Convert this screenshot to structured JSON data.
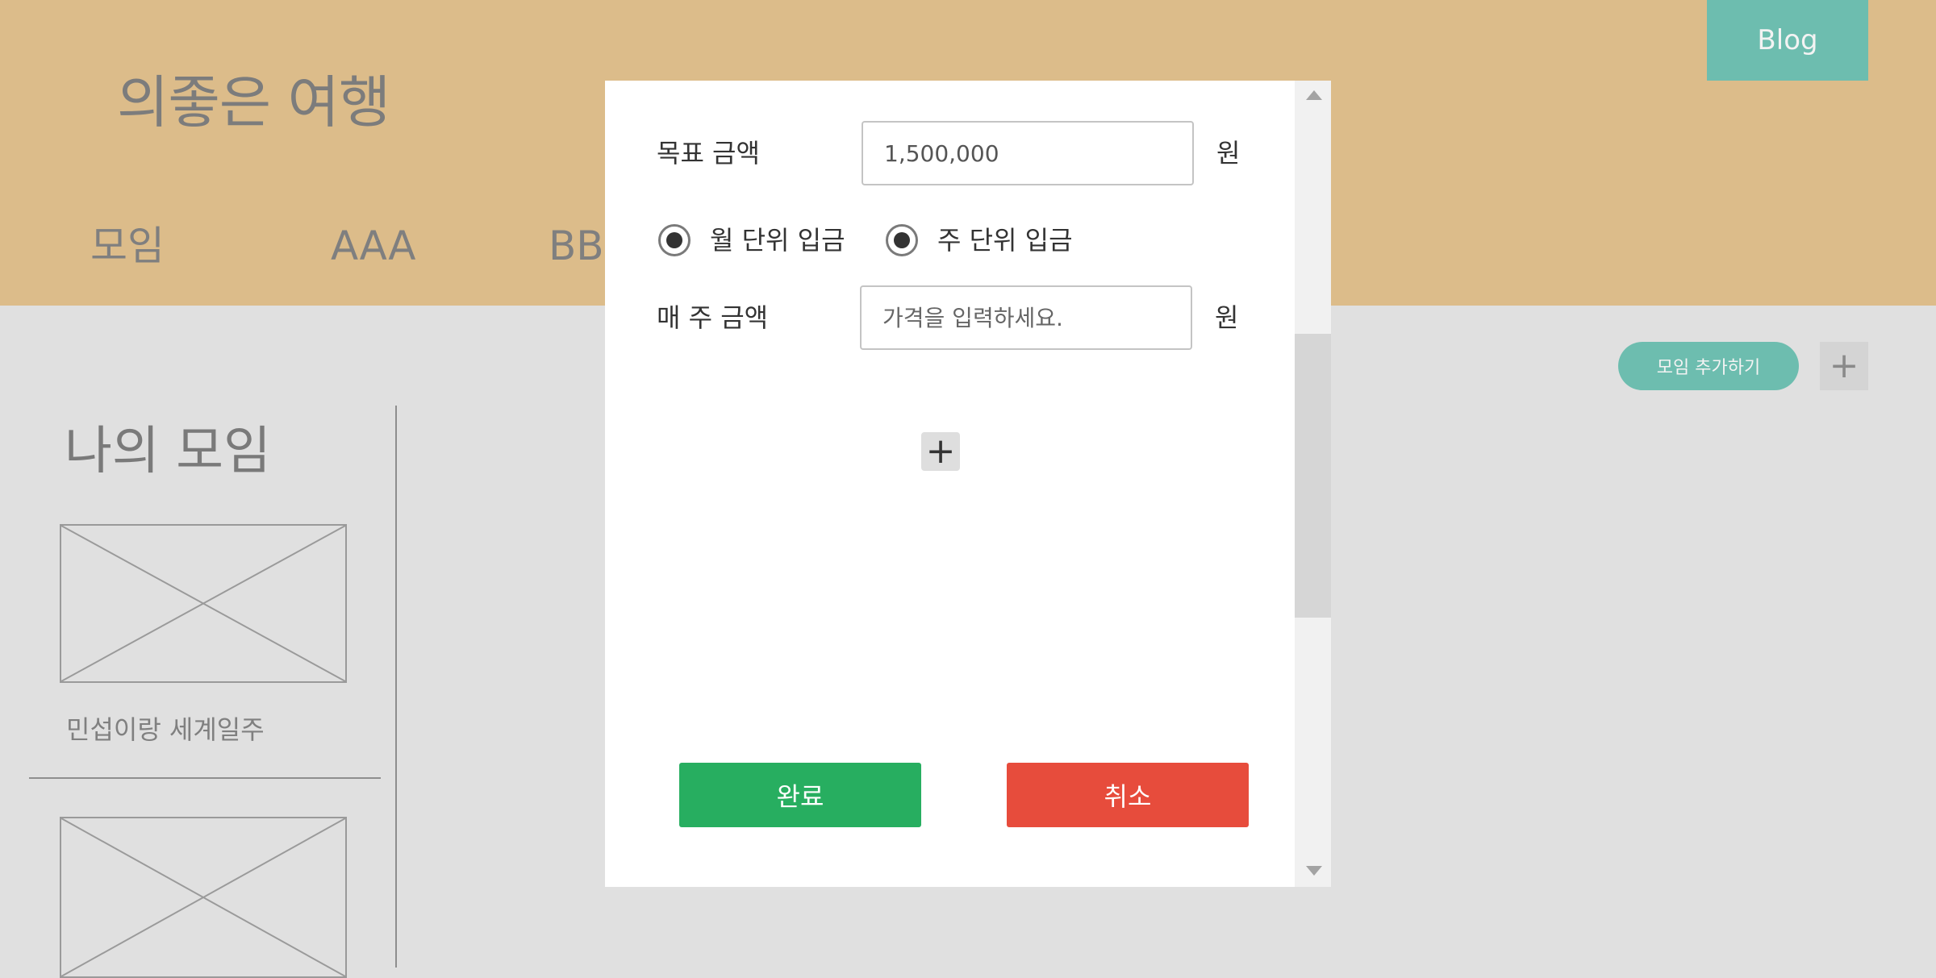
{
  "header": {
    "site_title": "의좋은 여행",
    "nav": [
      "모임",
      "AAA",
      "BBB"
    ],
    "blog_label": "Blog",
    "background_color": "#dcbc8a"
  },
  "content": {
    "add_group_label": "모임 추가하기",
    "add_icon": "plus-icon",
    "section_title": "나의 모임",
    "groups": [
      {
        "caption": "민섭이랑 세계일주",
        "image": "image-placeholder"
      },
      {
        "caption": "",
        "image": "image-placeholder"
      }
    ]
  },
  "modal": {
    "target_amount_label": "목표 금액",
    "target_amount_value": "1,500,000",
    "currency_unit": "원",
    "radio_monthly_label": "월 단위 입금",
    "radio_weekly_label": "주 단위 입금",
    "weekly_amount_label": "매 주 금액",
    "weekly_amount_placeholder": "가격을 입력하세요.",
    "add_icon": "plus-icon",
    "confirm_label": "완료",
    "cancel_label": "취소",
    "confirm_color": "#27ae60",
    "cancel_color": "#e74c3c"
  },
  "colors": {
    "accent_teal": "#6dbdaf",
    "page_background": "#e0e0e0"
  }
}
